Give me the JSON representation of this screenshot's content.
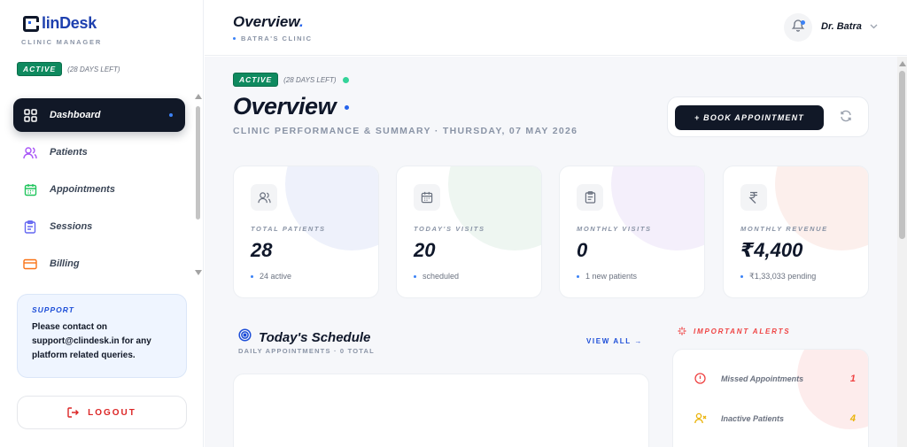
{
  "brand": {
    "name_prefix": "C",
    "name_rest": "linDesk",
    "subtitle": "CLINIC MANAGER"
  },
  "status": {
    "badge": "ACTIVE",
    "days_left": "(28 DAYS LEFT)"
  },
  "sidebar": {
    "items": [
      {
        "label": "Dashboard",
        "icon": "grid-icon",
        "active": true
      },
      {
        "label": "Patients",
        "icon": "users-icon",
        "color": "#a855f7"
      },
      {
        "label": "Appointments",
        "icon": "calendar-icon",
        "color": "#22c55e"
      },
      {
        "label": "Sessions",
        "icon": "clipboard-icon",
        "color": "#6366f1"
      },
      {
        "label": "Billing",
        "icon": "card-icon",
        "color": "#f97316"
      }
    ]
  },
  "support": {
    "title": "SUPPORT",
    "text": "Please contact on support@clindesk.in for any platform related queries."
  },
  "logout": {
    "label": "LOGOUT"
  },
  "header": {
    "title": "Overview",
    "subtitle": "BATRA'S CLINIC",
    "user": "Dr. Batra"
  },
  "main": {
    "title": "Overview",
    "subtitle": "CLINIC PERFORMANCE & SUMMARY · THURSDAY, 07 MAY 2026",
    "book_label": "+ BOOK APPOINTMENT"
  },
  "stats": [
    {
      "label": "TOTAL PATIENTS",
      "value": "28",
      "foot": "24 active",
      "icon": "users-icon",
      "blob": "#eef1fb"
    },
    {
      "label": "TODAY'S VISITS",
      "value": "20",
      "foot": "scheduled",
      "icon": "calendar-icon",
      "blob": "#eef6f1"
    },
    {
      "label": "MONTHLY VISITS",
      "value": "0",
      "foot": "1 new patients",
      "icon": "clipboard-icon",
      "blob": "#f4effb"
    },
    {
      "label": "MONTHLY REVENUE",
      "value": "₹4,400",
      "foot": "₹1,33,033 pending",
      "icon": "rupee-icon",
      "blob": "#fcefec"
    }
  ],
  "schedule": {
    "title": "Today's Schedule",
    "subtitle": "DAILY APPOINTMENTS · 0 TOTAL",
    "view_all": "VIEW ALL →"
  },
  "alerts": {
    "title": "IMPORTANT ALERTS",
    "items": [
      {
        "label": "Missed Appointments",
        "count": "1",
        "color": "#ef4444",
        "icon": "alert-circle-icon"
      },
      {
        "label": "Inactive Patients",
        "count": "4",
        "color": "#eab308",
        "icon": "user-x-icon"
      }
    ]
  }
}
